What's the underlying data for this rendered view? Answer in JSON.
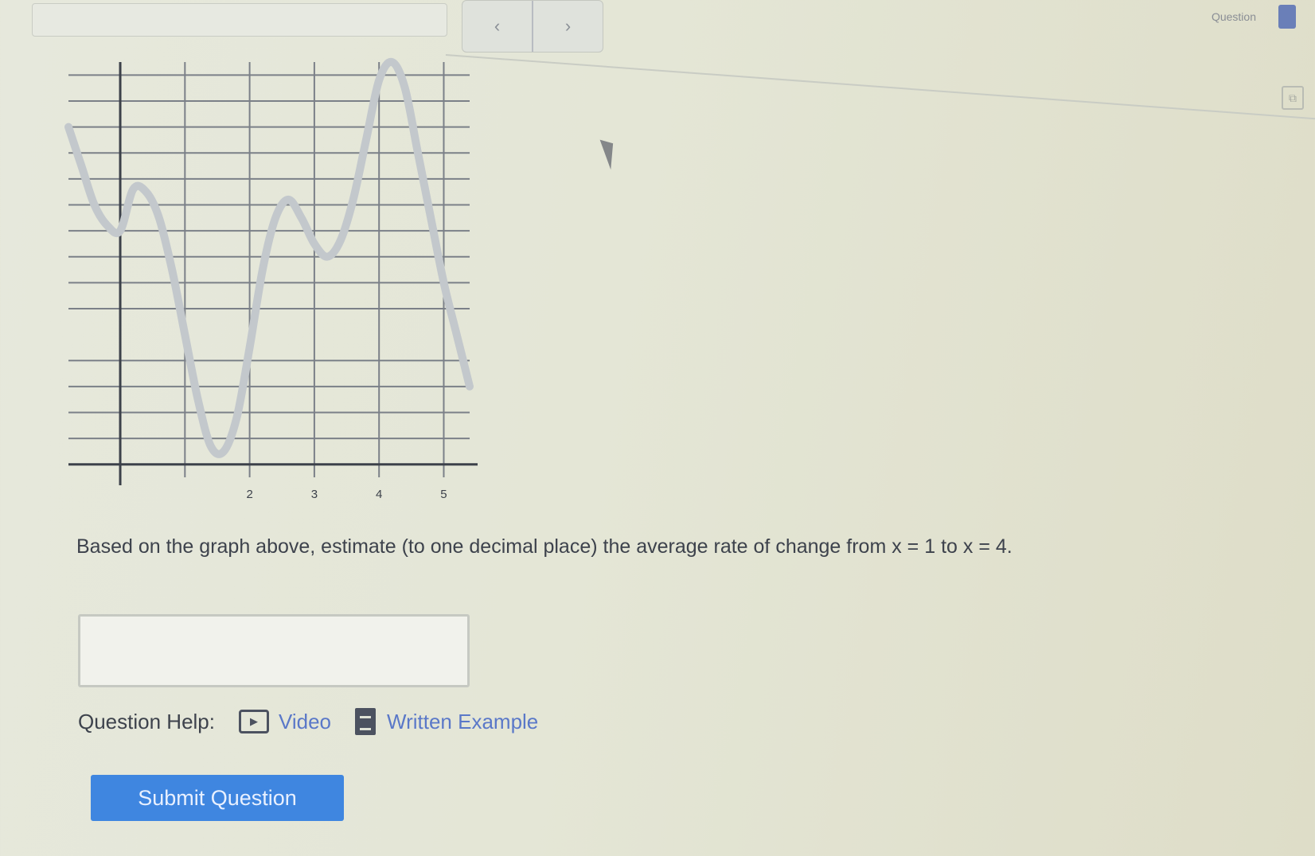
{
  "toolbar": {
    "nav_prev_icon": "‹",
    "nav_next_icon": "›",
    "question_info": "Question ",
    "account_label": ""
  },
  "chart_data": {
    "type": "line",
    "title": "",
    "xlabel": "",
    "ylabel": "",
    "xlim": [
      -0.8,
      5.4
    ],
    "ylim": [
      -5.5,
      10.5
    ],
    "x_ticks": [
      -1,
      1,
      2,
      3,
      4,
      5
    ],
    "x_tick_labels": [
      "",
      "",
      "2",
      "3",
      "4",
      "5"
    ],
    "y_ticks": [
      -5,
      -4,
      -3,
      -2,
      -1,
      1,
      2,
      3,
      4,
      5,
      6,
      7,
      8,
      9,
      10
    ],
    "y_tick_labels": [
      "",
      "",
      "",
      "",
      "",
      "",
      "",
      "",
      "",
      "",
      "",
      "",
      "",
      "",
      ""
    ],
    "grid": true,
    "series": [
      {
        "color": "#c3c8cc",
        "x": [
          -0.8,
          -0.6,
          -0.4,
          -0.2,
          0.0,
          0.2,
          0.4,
          0.6,
          0.8,
          1.0,
          1.2,
          1.4,
          1.6,
          1.8,
          2.0,
          2.2,
          2.4,
          2.6,
          2.8,
          3.0,
          3.2,
          3.4,
          3.6,
          3.8,
          4.0,
          4.2,
          4.4,
          4.6,
          4.8,
          5.0,
          5.2,
          5.4
        ],
        "y": [
          8.0,
          6.5,
          5.0,
          4.2,
          4.0,
          5.6,
          5.5,
          4.5,
          2.5,
          0.0,
          -2.5,
          -4.3,
          -4.5,
          -3.2,
          -0.5,
          2.5,
          4.5,
          5.2,
          4.5,
          3.5,
          3.0,
          3.6,
          5.2,
          7.5,
          9.8,
          10.5,
          9.5,
          7.0,
          4.5,
          2.0,
          0.0,
          -2.0
        ]
      }
    ]
  },
  "question": {
    "text": "Based on the graph above, estimate (to one decimal place) the average rate of change from x = 1 to x = 4."
  },
  "answer": {
    "value": ""
  },
  "help": {
    "label": "Question Help:",
    "video_label": "Video",
    "written_label": "Written Example"
  },
  "submit": {
    "label": "Submit Question"
  }
}
